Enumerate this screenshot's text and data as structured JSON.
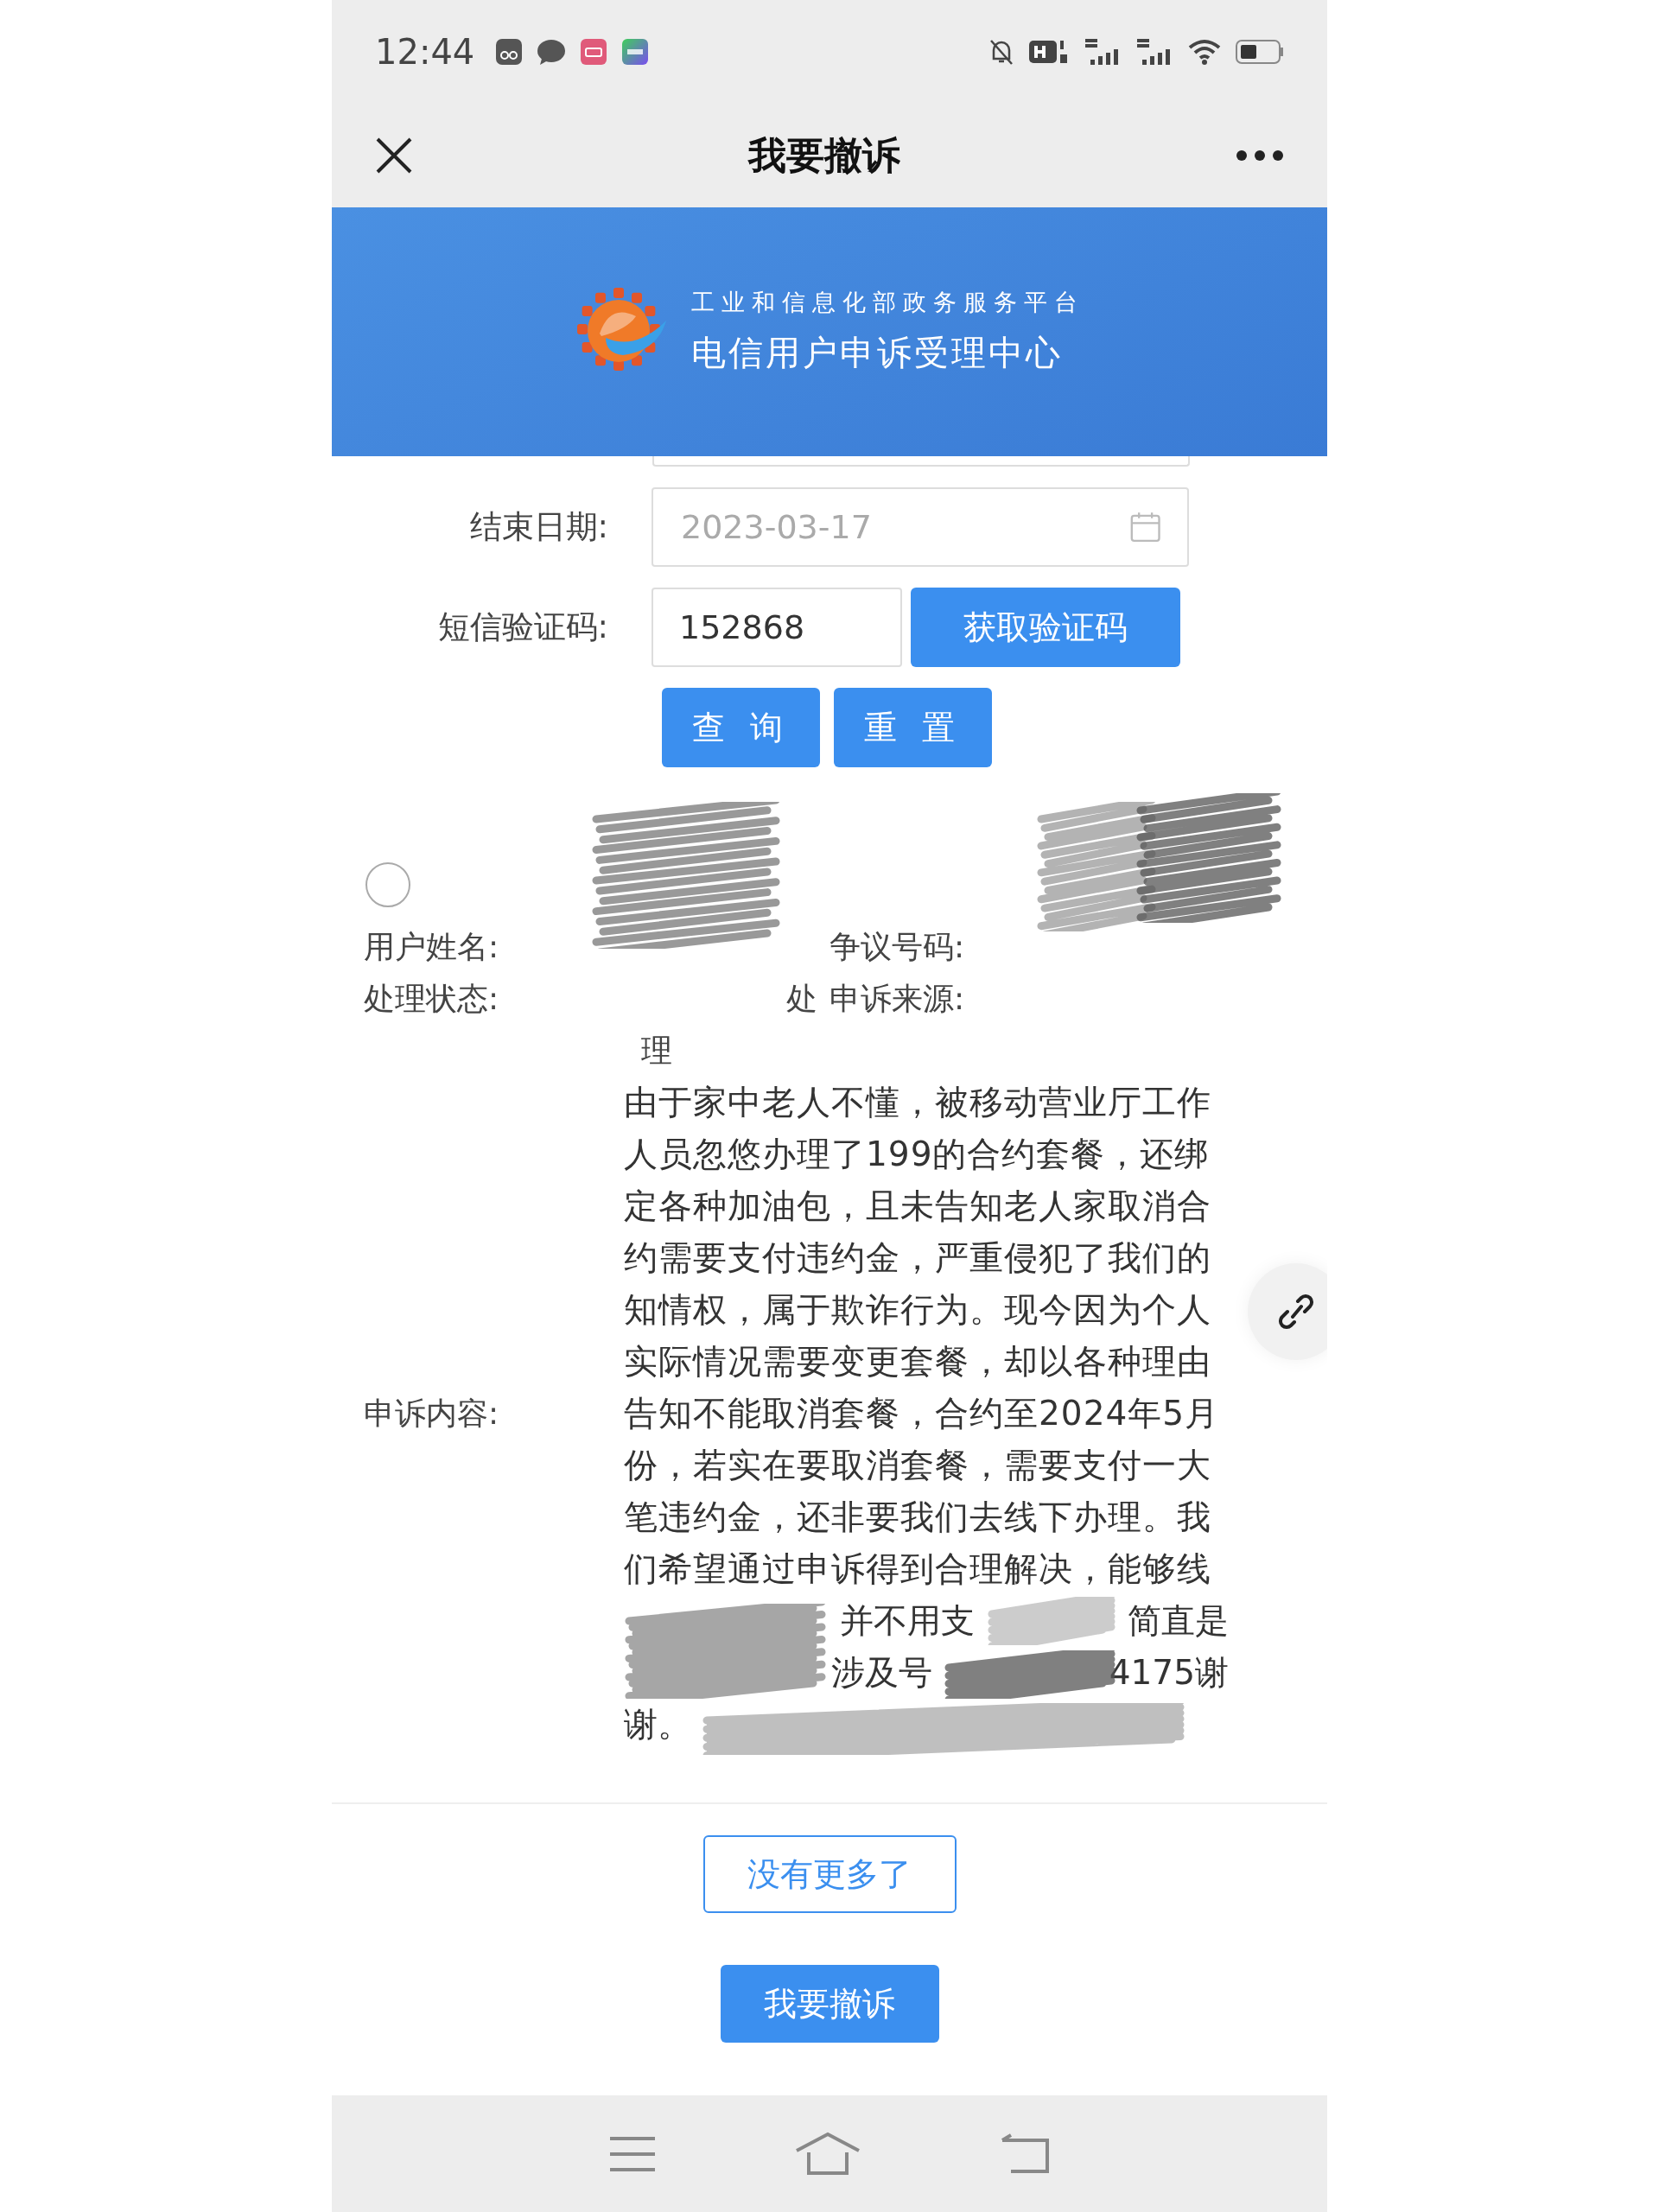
{
  "status_bar": {
    "time": "12:44"
  },
  "title_bar": {
    "title": "我要撤诉"
  },
  "banner": {
    "subtitle": "工业和信息化部政务服务平台",
    "title": "电信用户申诉受理中心"
  },
  "form": {
    "end_date": {
      "label": "结束日期:",
      "placeholder": "2023-03-17"
    },
    "sms_code": {
      "label": "短信验证码:",
      "value": "152868",
      "button": "获取验证码"
    },
    "buttons": [
      "查 询",
      "重 置"
    ]
  },
  "record": {
    "selected": false,
    "name_label": "用户姓名:",
    "dispute_label": "争议号码:",
    "status_label": "处理状态:",
    "status_fragments": [
      "处",
      "理"
    ],
    "source_label": "申诉来源:",
    "content_label": "申诉内容:",
    "content": "由于家中老人不懂，被移动营业厅工作人员忽悠办理了199的合约套餐，还绑定各种加油包，且未告知老人家取消合约需要支付违约金，严重侵犯了我们的知情权，属于欺诈行为。现今因为个人实际情况需要变更套餐，却以各种理由告知不能取消套餐，合约至2024年5月份，若实在要取消套餐，需要支付一大笔违约金，还非要我们去线下办理。我们希望通过申诉得到合理解决，能够线",
    "content_fragments": [
      [
        "并不用支",
        "简直是"
      ],
      [
        "涉及号",
        "4175谢"
      ],
      [
        "谢。"
      ]
    ]
  },
  "no_more": "没有更多了",
  "withdraw_button": "我要撤诉"
}
